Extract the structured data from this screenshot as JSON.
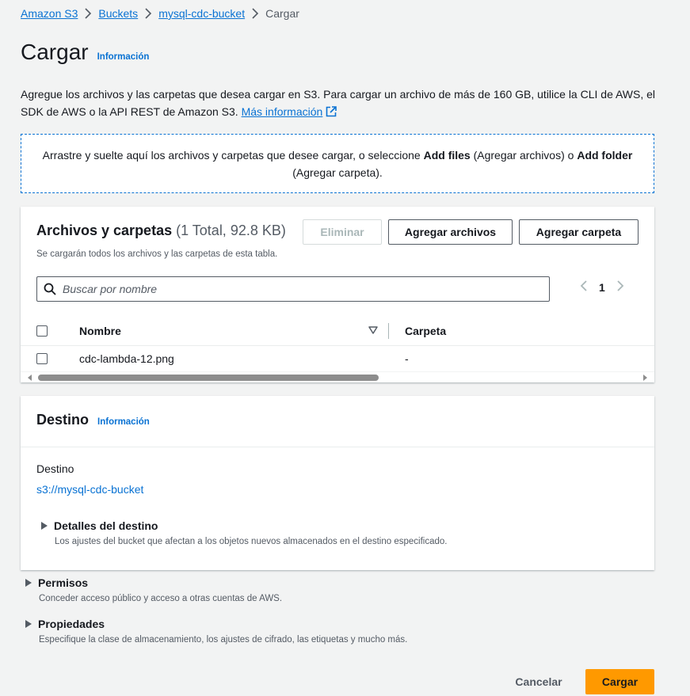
{
  "breadcrumb": {
    "items": [
      {
        "label": "Amazon S3"
      },
      {
        "label": "Buckets"
      },
      {
        "label": "mysql-cdc-bucket"
      }
    ],
    "current": "Cargar"
  },
  "page": {
    "title": "Cargar",
    "info_link": "Información",
    "description_text": "Agregue los archivos y las carpetas que desea cargar en S3. Para cargar un archivo de más de 160 GB, utilice la CLI de AWS, el SDK de AWS o la API REST de Amazon S3. ",
    "description_link": "Más información"
  },
  "dropzone": {
    "text_1": "Arrastre y suelte aquí los archivos y carpetas que desee cargar, o seleccione ",
    "add_files_bold": "Add files",
    "text_2": " (Agregar archivos) o ",
    "add_folder_bold": "Add folder",
    "text_3": " (Agregar carpeta)."
  },
  "files_panel": {
    "title": "Archivos y carpetas",
    "count": "(1 Total, 92.8 KB)",
    "subtitle": "Se cargarán todos los archivos y las carpetas de esta tabla.",
    "buttons": {
      "delete": "Eliminar",
      "add_files": "Agregar archivos",
      "add_folder": "Agregar carpeta"
    },
    "search": {
      "placeholder": "Buscar por nombre",
      "value": ""
    },
    "pagination": {
      "current_page": "1"
    },
    "columns": [
      "Nombre",
      "Carpeta"
    ],
    "rows": [
      {
        "name": "cdc-lambda-12.png",
        "folder": "-"
      }
    ]
  },
  "destination_panel": {
    "title": "Destino",
    "info_link": "Información",
    "label": "Destino",
    "value": "s3://mysql-cdc-bucket",
    "details": {
      "title": "Detalles del destino",
      "description": "Los ajustes del bucket que afectan a los objetos nuevos almacenados en el destino especificado."
    }
  },
  "permissions": {
    "title": "Permisos",
    "description": "Conceder acceso público y acceso a otras cuentas de AWS."
  },
  "properties": {
    "title": "Propiedades",
    "description": "Especifique la clase de almacenamiento, los ajustes de cifrado, las etiquetas y mucho más."
  },
  "footer": {
    "cancel": "Cancelar",
    "upload": "Cargar"
  },
  "colors": {
    "link": "#0972d3",
    "primary_button": "#ff9900",
    "background": "#f2f3f3",
    "text": "#16191f",
    "secondary_text": "#545b64"
  }
}
